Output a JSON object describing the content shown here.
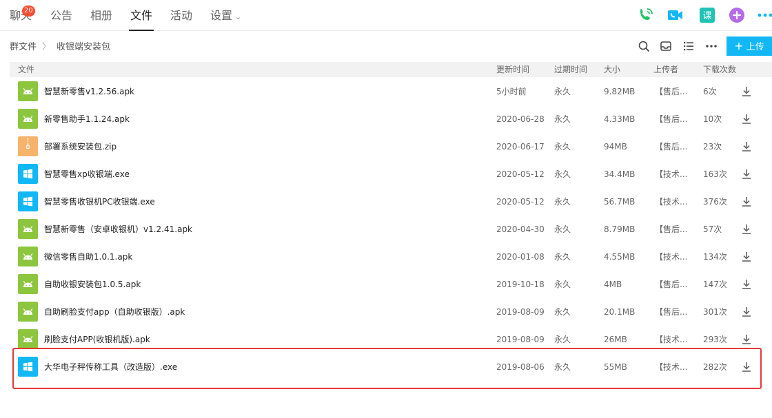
{
  "tabs": [
    {
      "label": "聊天",
      "badge": "20"
    },
    {
      "label": "公告"
    },
    {
      "label": "相册"
    },
    {
      "label": "文件",
      "active": true
    },
    {
      "label": "活动"
    },
    {
      "label": "设置"
    }
  ],
  "breadcrumb": {
    "root": "群文件",
    "current": "收银端安装包"
  },
  "upload_label": "上传",
  "columns": {
    "name": "文件",
    "updated": "更新时间",
    "expires": "过期时间",
    "size": "大小",
    "uploader": "上传者",
    "downloads": "下载次数"
  },
  "files": [
    {
      "type": "android",
      "name": "智慧新零售v1.2.56.apk",
      "updated": "5小时前",
      "expires": "永久",
      "size": "9.82MB",
      "uploader": "【售后...",
      "downloads": "6次"
    },
    {
      "type": "android",
      "name": "新零售助手1.1.24.apk",
      "updated": "2020-06-28",
      "expires": "永久",
      "size": "4.33MB",
      "uploader": "【售后...",
      "downloads": "10次"
    },
    {
      "type": "zip",
      "name": "部署系统安装包.zip",
      "updated": "2020-06-17",
      "expires": "永久",
      "size": "94MB",
      "uploader": "【售后...",
      "downloads": "23次"
    },
    {
      "type": "windows",
      "name": "智慧零售xp收银端.exe",
      "updated": "2020-05-12",
      "expires": "永久",
      "size": "34.4MB",
      "uploader": "【技术...",
      "downloads": "163次"
    },
    {
      "type": "windows",
      "name": "智慧零售收银机PC收银端.exe",
      "updated": "2020-05-12",
      "expires": "永久",
      "size": "56.7MB",
      "uploader": "【技术...",
      "downloads": "376次"
    },
    {
      "type": "android",
      "name": "智慧新零售（安卓收银机）v1.2.41.apk",
      "updated": "2020-04-30",
      "expires": "永久",
      "size": "8.79MB",
      "uploader": "【售后...",
      "downloads": "57次"
    },
    {
      "type": "android",
      "name": "微信零售自助1.0.1.apk",
      "updated": "2020-01-08",
      "expires": "永久",
      "size": "4.55MB",
      "uploader": "【技术...",
      "downloads": "134次"
    },
    {
      "type": "android",
      "name": "自助收银安装包1.0.5.apk",
      "updated": "2019-10-18",
      "expires": "永久",
      "size": "4MB",
      "uploader": "【售后...",
      "downloads": "147次"
    },
    {
      "type": "android",
      "name": "自助刷脸支付app（自助收银版）.apk",
      "updated": "2019-08-09",
      "expires": "永久",
      "size": "20.1MB",
      "uploader": "【售后...",
      "downloads": "301次"
    },
    {
      "type": "android",
      "name": "刷脸支付APP(收银机版).apk",
      "updated": "2019-08-09",
      "expires": "永久",
      "size": "26MB",
      "uploader": "【技术...",
      "downloads": "293次"
    },
    {
      "type": "windows",
      "name": "大华电子秤传称工具（改造版）.exe",
      "updated": "2019-08-06",
      "expires": "永久",
      "size": "55MB",
      "uploader": "【技术...",
      "downloads": "282次",
      "highlighted": true
    }
  ],
  "colors": {
    "android": "#8cc63e",
    "windows": "#12b7f5",
    "zip": "#f6b36b",
    "accent": "#12b7f5",
    "highlight": "#e53935"
  }
}
